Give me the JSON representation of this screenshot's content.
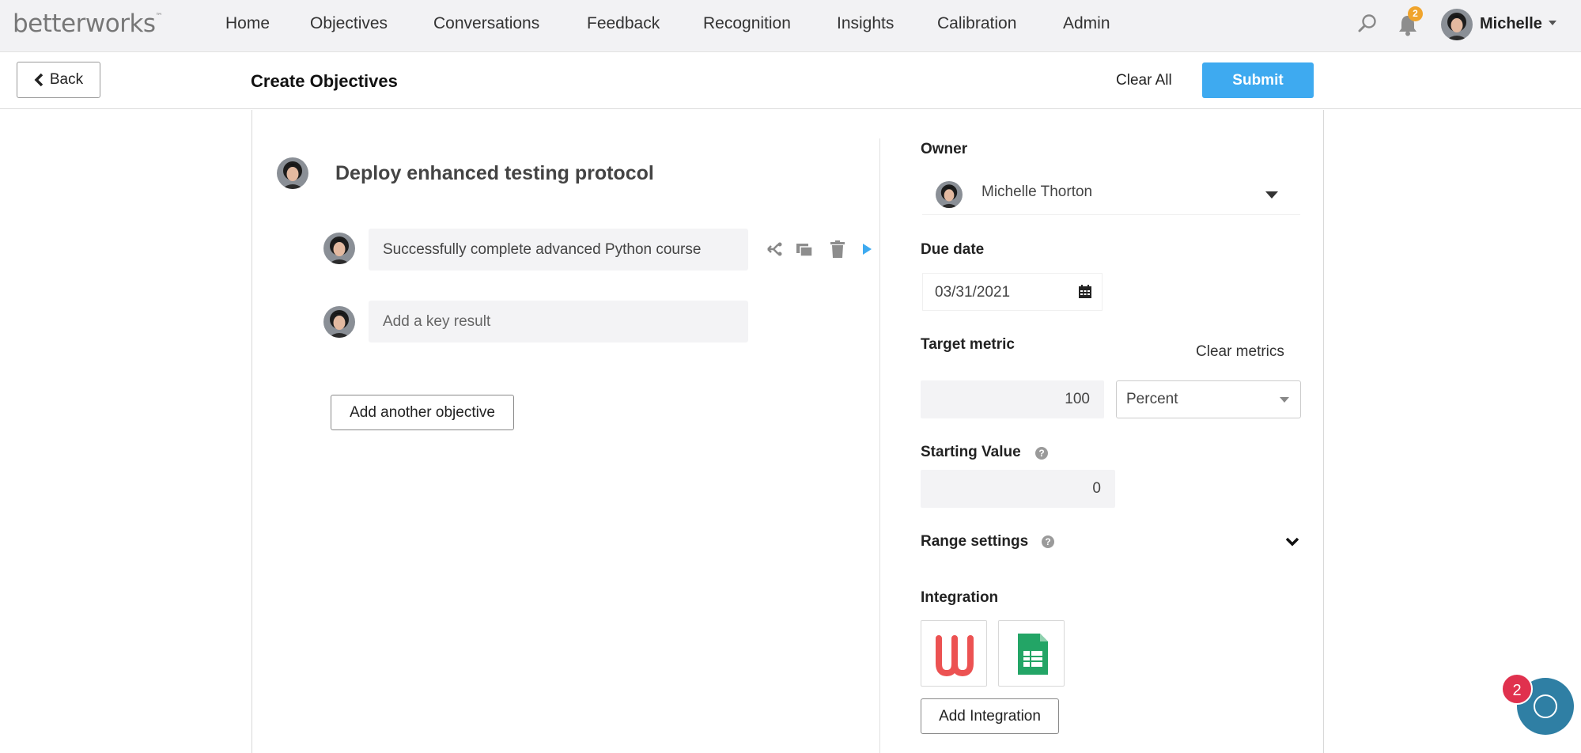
{
  "brand": {
    "logo_text": "betterworks",
    "trademark": "™"
  },
  "nav": {
    "items": [
      {
        "label": "Home"
      },
      {
        "label": "Objectives"
      },
      {
        "label": "Conversations"
      },
      {
        "label": "Feedback"
      },
      {
        "label": "Recognition"
      },
      {
        "label": "Insights"
      },
      {
        "label": "Calibration"
      },
      {
        "label": "Admin"
      }
    ],
    "notification_count": "2",
    "user_name": "Michelle"
  },
  "toolbar": {
    "back_label": "Back",
    "page_title": "Create Objectives",
    "clear_all_label": "Clear All",
    "submit_label": "Submit"
  },
  "objective": {
    "title": "Deploy enhanced testing protocol",
    "key_results": [
      {
        "text": "Successfully complete advanced Python course"
      }
    ],
    "add_key_result_placeholder": "Add a key result",
    "add_objective_label": "Add another objective"
  },
  "details": {
    "owner_label": "Owner",
    "owner_name": "Michelle Thorton",
    "due_date_label": "Due date",
    "due_date_value": "03/31/2021",
    "target_metric_label": "Target metric",
    "clear_metrics_label": "Clear metrics",
    "target_value": "100",
    "unit_value": "Percent",
    "starting_value_label": "Starting Value",
    "starting_value": "0",
    "range_settings_label": "Range settings",
    "integration_label": "Integration",
    "add_integration_label": "Add Integration",
    "help_glyph": "?"
  },
  "chat": {
    "unread_count": "2"
  },
  "colors": {
    "accent": "#3eaaf0",
    "badge_orange": "#f0a42c",
    "chat_blue": "#2f7fa4",
    "chat_badge_red": "#e0314e",
    "udemy_red": "#ec5252",
    "sheets_green": "#23a566"
  },
  "icons": [
    "search-icon",
    "bell-icon",
    "chevron-left-icon",
    "branch-icon",
    "copy-icon",
    "trash-icon",
    "play-arrow-icon",
    "calendar-icon",
    "help-icon",
    "chevron-down-icon",
    "udemy-icon",
    "google-sheets-icon",
    "chat-icon"
  ]
}
